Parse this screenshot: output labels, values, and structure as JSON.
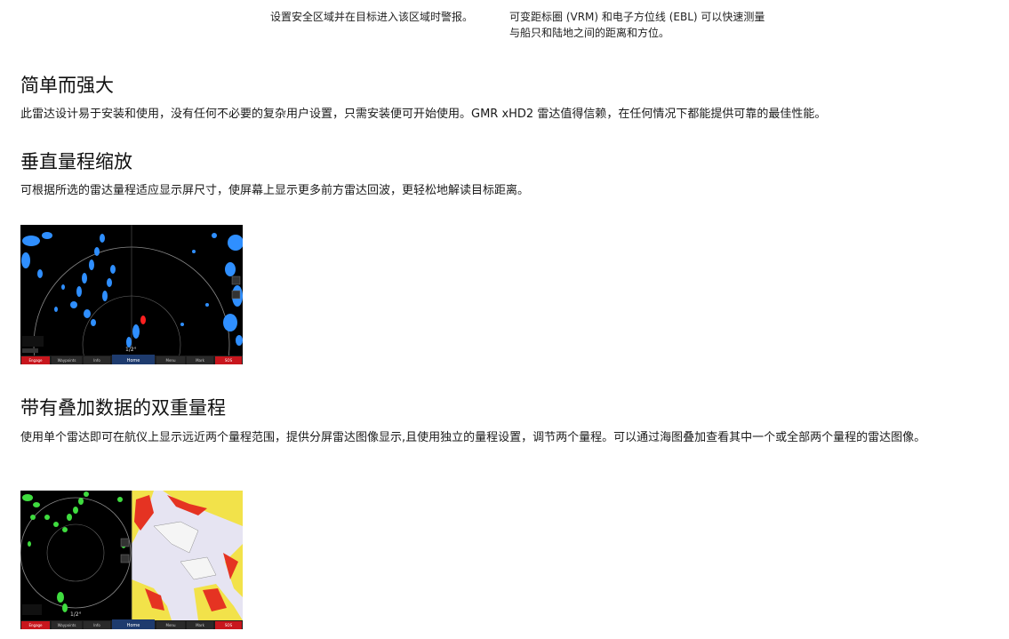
{
  "captions": {
    "left": "设置安全区域并在目标进入该区域时警报。",
    "right": "可变距标圈 (VRM) 和电子方位线 (EBL) 可以快速测量与船只和陆地之间的距离和方位。"
  },
  "sections": [
    {
      "title": "简单而强大",
      "text": "此雷达设计易于安装和使用，没有任何不必要的复杂用户设置，只需安装便可开始使用。GMR xHD2 雷达值得信赖，在任何情况下都能提供可靠的最佳性能。"
    },
    {
      "title": "垂直量程缩放",
      "text": "可根据所选的雷达量程适应显示屏尺寸，使屏幕上显示更多前方雷达回波，更轻松地解读目标距离。"
    },
    {
      "title": "带有叠加数据的双重量程",
      "text": "使用单个雷达即可在航仪上显示远近两个量程范围，提供分屏雷达图像显示,且使用独立的量程设置，调节两个量程。可以通过海图叠加查看其中一个或全部两个量程的雷达图像。"
    }
  ],
  "screens": {
    "radar1": {
      "range": "1/2°",
      "buttons": [
        "Engage",
        "Waypoints",
        "Info",
        "Home",
        "Menu",
        "Mark",
        "SOS"
      ]
    },
    "radar2": {
      "range": "1/2°",
      "buttons": [
        "Engage",
        "Waypoints",
        "Info",
        "Home",
        "Menu",
        "Mark",
        "SOS"
      ]
    }
  },
  "colors": {
    "radar_blue": "#2f8fff",
    "radar_green": "#3fdc3f",
    "echo_red": "#ff2020",
    "button_red": "#c8161d",
    "chart_yellow": "#f2e24a"
  }
}
